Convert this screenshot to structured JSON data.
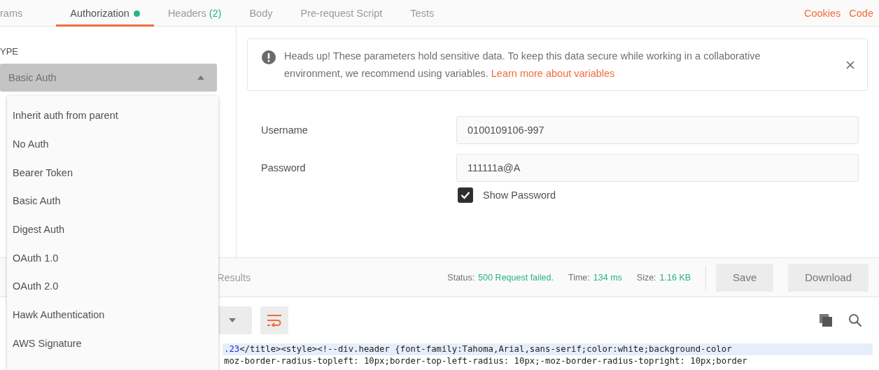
{
  "tabs": [
    {
      "label": "rams",
      "selected": false
    },
    {
      "label": "Authorization",
      "selected": true,
      "dot": true
    },
    {
      "label": "Headers",
      "count": "(2)",
      "selected": false
    },
    {
      "label": "Body",
      "selected": false
    },
    {
      "label": "Pre-request Script",
      "selected": false
    },
    {
      "label": "Tests",
      "selected": false
    }
  ],
  "top_links": [
    "Cookies",
    "Code"
  ],
  "auth": {
    "type_label": "YPE",
    "type_value": "Basic Auth",
    "menu_open": true,
    "menu_items": [
      "Inherit auth from parent",
      "No Auth",
      "Bearer Token",
      "Basic Auth",
      "Digest Auth",
      "OAuth 1.0",
      "OAuth 2.0",
      "Hawk Authentication",
      "AWS Signature"
    ]
  },
  "alert": {
    "text": "Heads up! These parameters hold sensitive data. To keep this data secure while working in a collaborative environment, we recommend using variables.",
    "link": "Learn more about variables"
  },
  "fields": [
    {
      "label": "Username",
      "value": "0100109106-997"
    },
    {
      "label": "Password",
      "value": "111111a@A"
    }
  ],
  "show_password": {
    "label": "Show Password",
    "checked": true
  },
  "response": {
    "tabs": [
      "Results"
    ],
    "status": [
      {
        "label": "Status:",
        "value": "500 Request failed."
      },
      {
        "label": "Time:",
        "value": "134 ms"
      },
      {
        "label": "Size:",
        "value": "1.16 KB"
      }
    ],
    "buttons": [
      "Save",
      "Download"
    ],
    "code_lines": [
      [
        {
          "kind": "number",
          "text": ".23"
        },
        {
          "kind": "tag",
          "text": "</title><style><!--div.header {font-family:Tahoma,Arial,sans-serif;color:white;background-color"
        }
      ],
      [
        {
          "kind": "tag",
          "text": "moz-border-radius-topleft: 10px;border-top-left-radius: 10px;-moz-border-radius-topright: 10px;border"
        }
      ]
    ]
  }
}
